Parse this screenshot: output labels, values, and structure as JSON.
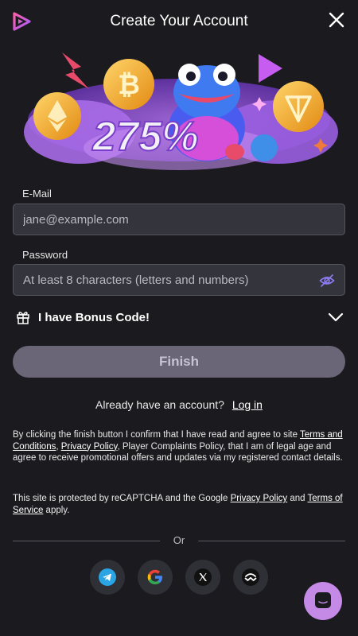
{
  "header": {
    "title": "Create Your Account",
    "logo_icon": "play-logo-icon",
    "close_icon": "close-icon"
  },
  "banner": {
    "promo_text": "275%",
    "colors": {
      "purple": "#7b3fe4",
      "pink": "#d64fd9",
      "gold": "#f0a92b",
      "blue": "#3f8ee8"
    }
  },
  "form": {
    "email_label": "E-Mail",
    "email_placeholder": "jane@example.com",
    "password_label": "Password",
    "password_placeholder": "At least 8 characters (letters and numbers)",
    "bonus_label": "I have Bonus Code!",
    "finish_label": "Finish"
  },
  "login": {
    "prompt": "Already have an account?",
    "link": "Log in"
  },
  "legal": {
    "p1_a": "By clicking the finish button I confirm that I have read and agree to site ",
    "terms_link": "Terms and Conditions",
    "p1_b": ", ",
    "privacy_link": "Privacy Policy",
    "p1_c": ", Player Complaints Policy, that I am of legal age and agree to receive promotional offers and updates via my registered contact details.",
    "p2_a": "This site is protected by reCAPTCHA and the Google ",
    "google_privacy_link": "Privacy Policy",
    "p2_b": " and ",
    "tos_link": "Terms of Service",
    "p2_c": " apply."
  },
  "divider": {
    "or_text": "Or"
  },
  "social": [
    "telegram-icon",
    "google-icon",
    "x-icon",
    "walletconnect-icon"
  ],
  "colors": {
    "background": "#1b1b1f",
    "field": "#34343c",
    "button": "#6b6578",
    "chat": "#c48ae6"
  }
}
